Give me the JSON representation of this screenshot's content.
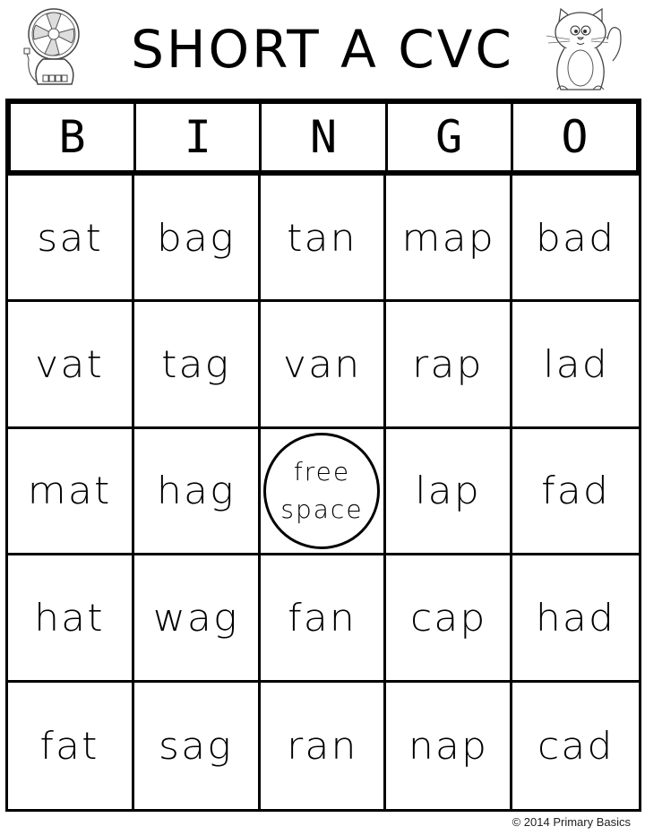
{
  "title": "SHORT A CVC",
  "decorations": {
    "left_image": "fan-icon",
    "right_image": "cat-icon"
  },
  "bingo": {
    "headers": [
      "B",
      "I",
      "N",
      "G",
      "O"
    ],
    "rows": [
      [
        "sat",
        "bag",
        "tan",
        "map",
        "bad"
      ],
      [
        "vat",
        "tag",
        "van",
        "rap",
        "lad"
      ],
      [
        "mat",
        "hag",
        "free space",
        "lap",
        "fad"
      ],
      [
        "hat",
        "wag",
        "fan",
        "cap",
        "had"
      ],
      [
        "fat",
        "sag",
        "ran",
        "nap",
        "cad"
      ]
    ],
    "free_space": {
      "line1": "free",
      "line2": "space"
    }
  },
  "footer": {
    "copyright": "© 2014 Primary Basics"
  }
}
